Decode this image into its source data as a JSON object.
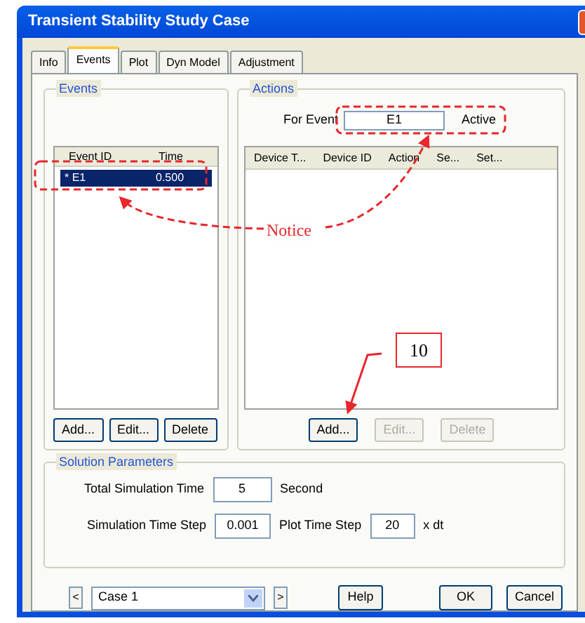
{
  "window": {
    "title": "Transient Stability Study Case"
  },
  "tabs": [
    {
      "label": "Info",
      "selected": false
    },
    {
      "label": "Events",
      "selected": true
    },
    {
      "label": "Plot",
      "selected": false
    },
    {
      "label": "Dyn Model",
      "selected": false
    },
    {
      "label": "Adjustment",
      "selected": false
    }
  ],
  "events": {
    "title": "Events",
    "columns": [
      "Event ID",
      "Time"
    ],
    "rows": [
      {
        "cells": [
          "* E1",
          "0.500"
        ],
        "selected": true
      }
    ],
    "buttons": [
      {
        "label": "Add...",
        "disabled": false
      },
      {
        "label": "Edit...",
        "disabled": false
      },
      {
        "label": "Delete",
        "disabled": false
      }
    ]
  },
  "actions": {
    "title": "Actions",
    "for_event_label": "For Event",
    "for_event_value": "E1",
    "status": "Active",
    "columns": [
      "Device T...",
      "Device ID",
      "Action",
      "Se...",
      "Set..."
    ],
    "buttons": [
      {
        "label": "Add...",
        "disabled": false
      },
      {
        "label": "Edit...",
        "disabled": true
      },
      {
        "label": "Delete",
        "disabled": true
      }
    ]
  },
  "solution_parameters": {
    "title": "Solution Parameters",
    "total_time_label": "Total Simulation Time",
    "total_time": "5",
    "total_time_unit": "Second",
    "time_step_label": "Simulation Time Step",
    "time_step": "0.001",
    "plot_step_label": "Plot Time Step",
    "plot_step": "20",
    "plot_step_unit": "x dt"
  },
  "footer": {
    "prev": "<",
    "case": "Case 1",
    "next": ">",
    "buttons": [
      "Help",
      "OK",
      "Cancel"
    ]
  },
  "annotations": {
    "notice": "Notice",
    "callout": "10"
  }
}
